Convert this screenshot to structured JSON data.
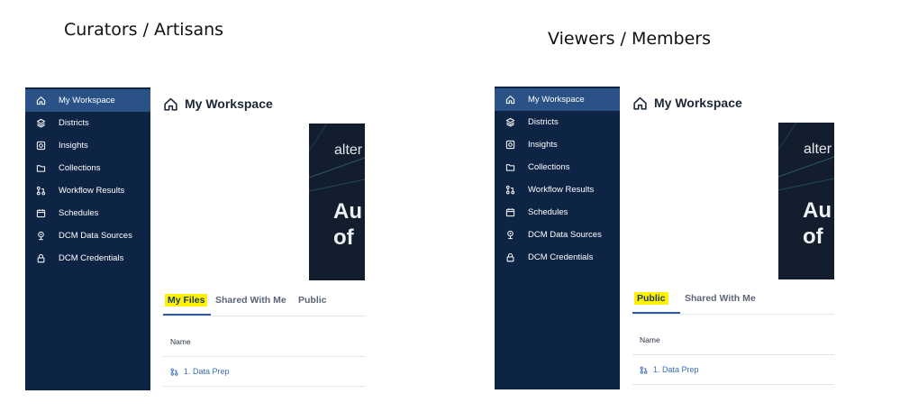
{
  "headings": {
    "left": "Curators / Artisans",
    "right": "Viewers / Members"
  },
  "sidebar": {
    "active_index": 0,
    "items": [
      {
        "label": "My Workspace",
        "icon": "home-icon"
      },
      {
        "label": "Districts",
        "icon": "layers-icon"
      },
      {
        "label": "Insights",
        "icon": "insights-icon"
      },
      {
        "label": "Collections",
        "icon": "folder-icon"
      },
      {
        "label": "Workflow Results",
        "icon": "workflow-icon"
      },
      {
        "label": "Schedules",
        "icon": "calendar-icon"
      },
      {
        "label": "DCM Data Sources",
        "icon": "data-source-icon"
      },
      {
        "label": "DCM Credentials",
        "icon": "lock-icon"
      }
    ]
  },
  "workspace": {
    "title": "My Workspace",
    "banner": {
      "brand": "alter",
      "line1": "Au",
      "line2": "of"
    }
  },
  "curator_view": {
    "tabs": [
      {
        "label": "My Files",
        "active": true,
        "highlighted": true
      },
      {
        "label": "Shared With Me",
        "active": false,
        "highlighted": false
      },
      {
        "label": "Public",
        "active": false,
        "highlighted": false
      }
    ],
    "table": {
      "column_header": "Name",
      "rows": [
        {
          "name": "1. Data Prep",
          "icon": "workflow-icon"
        }
      ]
    }
  },
  "viewer_view": {
    "tabs": [
      {
        "label": "Public",
        "active": true,
        "highlighted": true
      },
      {
        "label": "Shared With Me",
        "active": false,
        "highlighted": false
      }
    ],
    "table": {
      "column_header": "Name",
      "rows": [
        {
          "name": "1. Data Prep",
          "icon": "workflow-icon"
        }
      ]
    }
  },
  "colors": {
    "sidebar_bg": "#0e2444",
    "sidebar_active": "#2a5286",
    "highlight": "#fff200",
    "link": "#3b6fb6",
    "tab_underline": "#2e5d9c"
  }
}
